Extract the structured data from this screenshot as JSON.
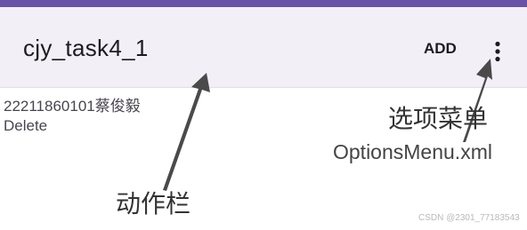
{
  "app_bar": {
    "title": "cjy_task4_1",
    "add_action_label": "ADD",
    "overflow_icon": "more-vertical-icon"
  },
  "content": {
    "items": [
      "22211860101蔡俊毅",
      "Delete"
    ]
  },
  "annotations": {
    "options_menu_label": "选项菜单",
    "options_menu_file": "OptionsMenu.xml",
    "action_bar_label": "动作栏"
  },
  "watermark": "CSDN @2301_77183543",
  "colors": {
    "status_strip": "#6a53a6",
    "app_bar_background": "#f3eff7",
    "arrow": "#4a4a4a"
  }
}
